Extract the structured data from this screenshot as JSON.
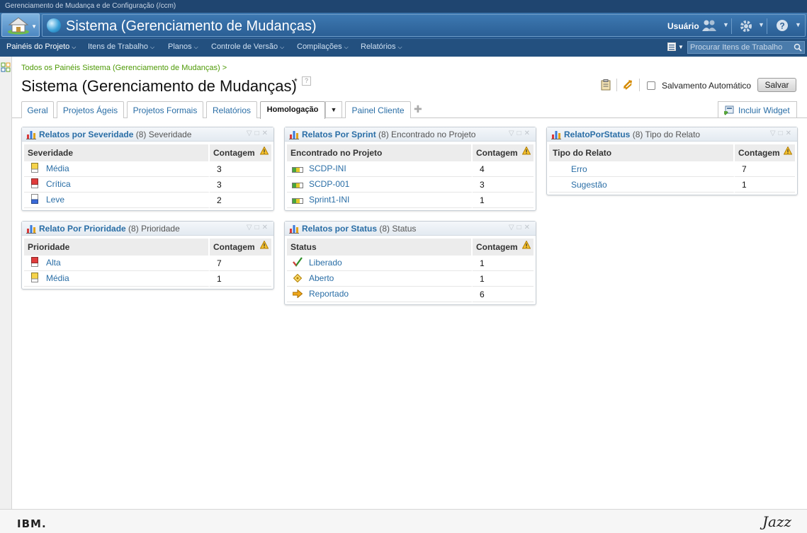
{
  "top_strip": {
    "text": "Gerenciamento de Mudança e de Configuração (/ccm)"
  },
  "header": {
    "app_title": "Sistema (Gerenciamento de Mudanças)",
    "user_label": "Usuário"
  },
  "menu": {
    "items": [
      {
        "label": "Painéis do Projeto"
      },
      {
        "label": "Itens de Trabalho"
      },
      {
        "label": "Planos"
      },
      {
        "label": "Controle de Versão"
      },
      {
        "label": "Compilações"
      },
      {
        "label": "Relatórios"
      }
    ],
    "search_placeholder": "Procurar Itens de Trabalho"
  },
  "page": {
    "breadcrumb": "Todos os Painéis Sistema (Gerenciamento de Mudanças) >",
    "title": "Sistema (Gerenciamento de Mudanças)",
    "modified_marker": "*",
    "help_marker": "?",
    "autosave_label": "Salvamento Automático",
    "save_label": "Salvar"
  },
  "tabs": [
    {
      "label": "Geral"
    },
    {
      "label": "Projetos Ágeis"
    },
    {
      "label": "Projetos Formais"
    },
    {
      "label": "Relatórios"
    },
    {
      "label": "Homologação"
    },
    {
      "label": "Painel Cliente"
    }
  ],
  "include_widget_label": "Incluir Widget",
  "widgets": [
    {
      "title": "Relatos por Severidade",
      "count": "(8)",
      "subtitle": "Severidade",
      "col1": "Severidade",
      "col2": "Contagem",
      "rows": [
        {
          "icon": "severity-medium-icon",
          "label": "Média",
          "value": "3"
        },
        {
          "icon": "severity-critical-icon",
          "label": "Crítica",
          "value": "3"
        },
        {
          "icon": "severity-low-icon",
          "label": "Leve",
          "value": "2"
        }
      ]
    },
    {
      "title": "Relatos Por Sprint",
      "count": "(8)",
      "subtitle": "Encontrado no Projeto",
      "col1": "Encontrado no Projeto",
      "col2": "Contagem",
      "rows": [
        {
          "icon": "iteration-icon",
          "label": "SCDP-INI",
          "value": "4"
        },
        {
          "icon": "iteration-icon",
          "label": "SCDP-001",
          "value": "3"
        },
        {
          "icon": "iteration-icon",
          "label": "Sprint1-INI",
          "value": "1"
        }
      ]
    },
    {
      "title": "RelatoPorStatus",
      "count": "(8)",
      "subtitle": "Tipo do Relato",
      "col1": "Tipo do Relato",
      "col2": "Contagem",
      "rows": [
        {
          "icon": "none",
          "label": "Erro",
          "value": "7"
        },
        {
          "icon": "none",
          "label": "Sugestão",
          "value": "1"
        }
      ]
    },
    {
      "title": "Relato Por Prioridade",
      "count": "(8)",
      "subtitle": "Prioridade",
      "col1": "Prioridade",
      "col2": "Contagem",
      "rows": [
        {
          "icon": "priority-high-icon",
          "label": "Alta",
          "value": "7"
        },
        {
          "icon": "priority-medium-icon",
          "label": "Média",
          "value": "1"
        }
      ]
    },
    {
      "title": "Relatos por Status",
      "count": "(8)",
      "subtitle": "Status",
      "col1": "Status",
      "col2": "Contagem",
      "rows": [
        {
          "icon": "status-resolved-icon",
          "label": "Liberado",
          "value": "1"
        },
        {
          "icon": "status-open-icon",
          "label": "Aberto",
          "value": "1"
        },
        {
          "icon": "status-reported-icon",
          "label": "Reportado",
          "value": "6"
        }
      ]
    }
  ],
  "footer": {
    "ibm": "IBM.",
    "jazz": "Jazz"
  }
}
